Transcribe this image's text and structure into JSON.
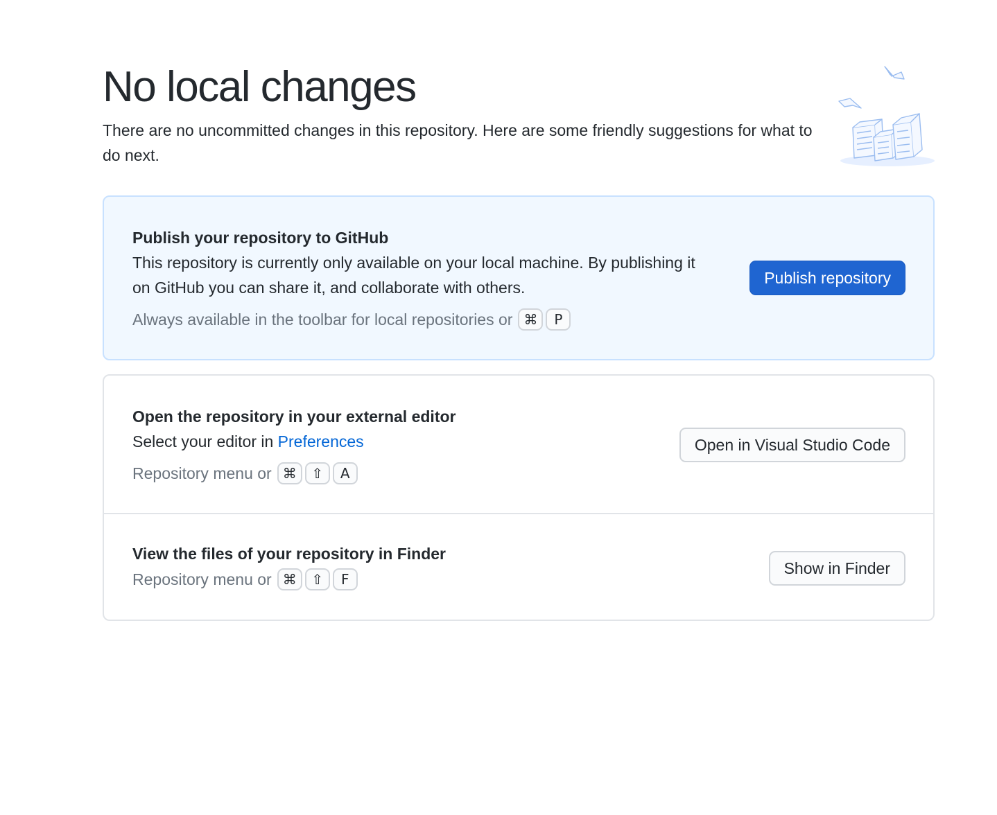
{
  "header": {
    "title": "No local changes",
    "subtitle": "There are no uncommitted changes in this repository. Here are some friendly suggestions for what to do next."
  },
  "publish": {
    "title": "Publish your repository to GitHub",
    "description": "This repository is currently only available on your local machine. By publishing it on GitHub you can share it, and collaborate with others.",
    "hint": "Always available in the toolbar for local repositories or",
    "shortcut": [
      "⌘",
      "P"
    ],
    "button_label": "Publish repository"
  },
  "editor": {
    "title": "Open the repository in your external editor",
    "description_prefix": "Select your editor in ",
    "preferences_link": "Preferences",
    "hint": "Repository menu or",
    "shortcut": [
      "⌘",
      "⇧",
      "A"
    ],
    "button_label": "Open in Visual Studio Code"
  },
  "finder": {
    "title": "View the files of your repository in Finder",
    "hint": "Repository menu or",
    "shortcut": [
      "⌘",
      "⇧",
      "F"
    ],
    "button_label": "Show in Finder"
  },
  "colors": {
    "accent": "#1f65d1",
    "link": "#0366d6",
    "publish_background": "#f1f8ff",
    "muted_text": "#6a737d"
  },
  "icons": {
    "illustration": "empty-repository-illustration-icon",
    "command_key": "command-key-icon",
    "shift_key": "shift-key-icon"
  }
}
